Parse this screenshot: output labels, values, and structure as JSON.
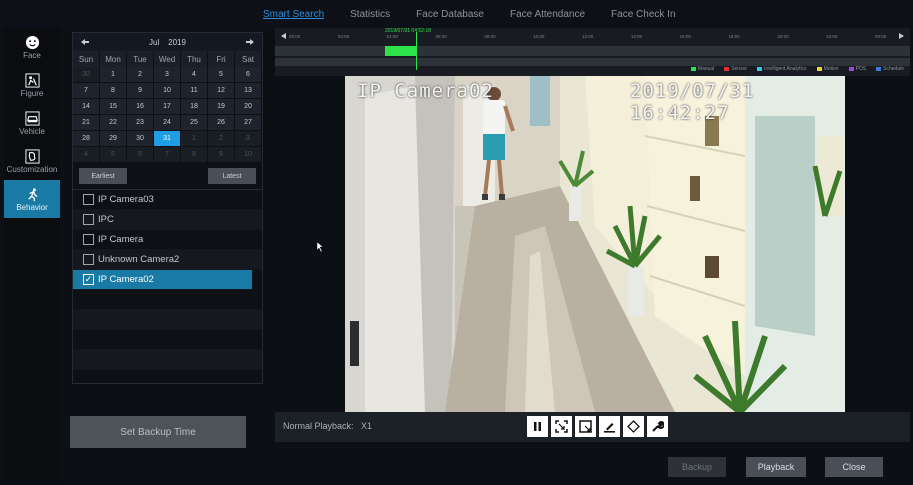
{
  "tabs": [
    "Smart Search",
    "Statistics",
    "Face Database",
    "Face Attendance",
    "Face Check In"
  ],
  "nav": [
    {
      "label": "Face",
      "icon": "face-icon"
    },
    {
      "label": "Figure",
      "icon": "figure-icon"
    },
    {
      "label": "Vehicle",
      "icon": "vehicle-icon"
    },
    {
      "label": "Customization",
      "icon": "customization-icon"
    },
    {
      "label": "Behavior",
      "icon": "behavior-icon"
    }
  ],
  "calendar": {
    "prev": "◆",
    "next": "➡",
    "month": "Jul",
    "year": "2019",
    "weekdays": [
      "Sun",
      "Mon",
      "Tue",
      "Wed",
      "Thu",
      "Fri",
      "Sat"
    ],
    "rows": [
      [
        "30",
        "1",
        "2",
        "3",
        "4",
        "5",
        "6"
      ],
      [
        "7",
        "8",
        "9",
        "10",
        "11",
        "12",
        "13"
      ],
      [
        "14",
        "15",
        "16",
        "17",
        "18",
        "19",
        "20"
      ],
      [
        "21",
        "22",
        "23",
        "24",
        "25",
        "26",
        "27"
      ],
      [
        "28",
        "29",
        "30",
        "31",
        "1",
        "2",
        "3"
      ],
      [
        "4",
        "5",
        "6",
        "7",
        "8",
        "9",
        "10"
      ]
    ],
    "selected_day": "31",
    "earliest": "Earliest",
    "latest": "Latest"
  },
  "cameras": [
    {
      "name": "IP Camera03",
      "checked": false
    },
    {
      "name": "IPC",
      "checked": false
    },
    {
      "name": "IP Camera",
      "checked": false
    },
    {
      "name": "Unknown Camera2",
      "checked": false
    },
    {
      "name": "IP Camera02",
      "checked": true
    }
  ],
  "set_backup_time": "Set Backup Time",
  "timeline": {
    "stamp": "2019/07/31 04:52:18",
    "labels": [
      "00:00",
      "02:00",
      "04:00",
      "06:00",
      "08:00",
      "10:00",
      "12:00",
      "14:00",
      "16:00",
      "18:00",
      "20:00",
      "22:00",
      "00:00"
    ],
    "legend": [
      {
        "label": "Manual",
        "color": "#2ee24a"
      },
      {
        "label": "Sensor",
        "color": "#e03030"
      },
      {
        "label": "Intelligent Analytics",
        "color": "#38c8e8"
      },
      {
        "label": "Motion",
        "color": "#e8d830"
      },
      {
        "label": "POS",
        "color": "#9a4ae0"
      },
      {
        "label": "Schedule",
        "color": "#3a7ae0"
      }
    ]
  },
  "video": {
    "camera_name": "IP Camera02",
    "datetime": "2019/07/31 16:42:27"
  },
  "playback": {
    "label": "Normal Playback:",
    "speed": "X1"
  },
  "buttons": {
    "backup": "Backup",
    "playback": "Playback",
    "close": "Close"
  }
}
